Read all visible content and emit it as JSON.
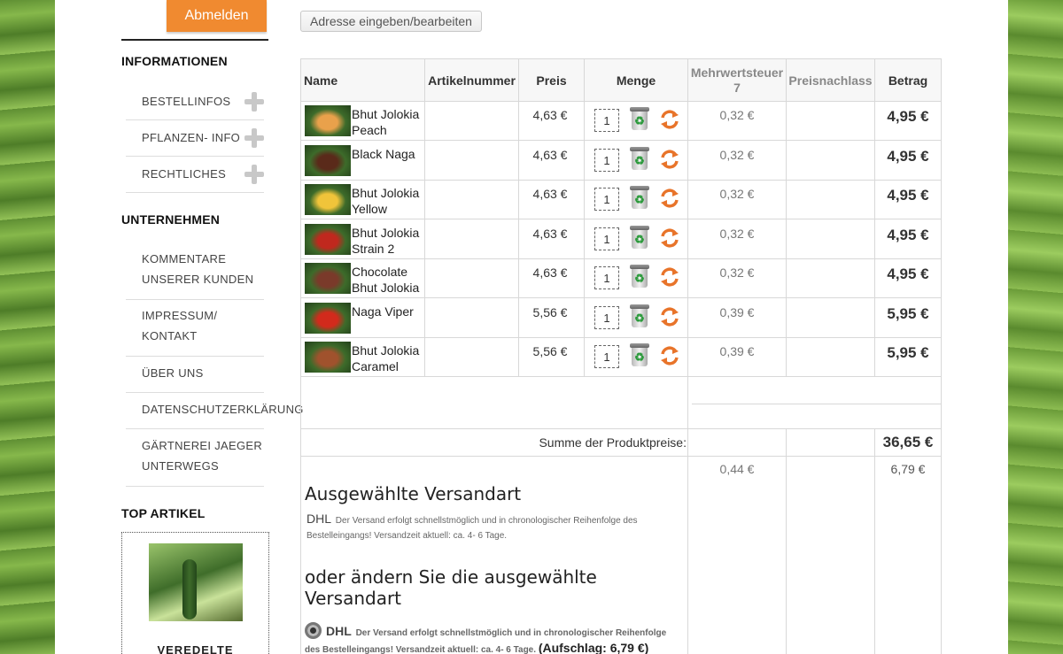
{
  "sidebar": {
    "logout_label": "Abmelden",
    "info_heading": "INFORMATIONEN",
    "info_items": [
      {
        "label": "BESTELLINFOS"
      },
      {
        "label": "PFLANZEN- INFO"
      },
      {
        "label": "RECHTLICHES"
      }
    ],
    "company_heading": "UNTERNEHMEN",
    "company_items": [
      {
        "line1": "KOMMENTARE",
        "line2": "UNSERER KUNDEN"
      },
      {
        "line1": "IMPRESSUM/",
        "line2": "KONTAKT"
      },
      {
        "line1": "ÜBER UNS",
        "line2": ""
      },
      {
        "line1": "DATENSCHUTZERKLÄRUNG",
        "line2": ""
      },
      {
        "line1": "GÄRTNEREI JAEGER",
        "line2": "UNTERWEGS"
      }
    ],
    "top_heading": "TOP ARTIKEL",
    "top_article_title": "VEREDELTE"
  },
  "address_button": "Adresse eingeben/bearbeiten",
  "table": {
    "headers": {
      "name": "Name",
      "article_number": "Artikelnummer",
      "price": "Preis",
      "quantity": "Menge",
      "vat_line1": "Mehrwertsteuer",
      "vat_line2": "7",
      "discount": "Preisnachlass",
      "amount": "Betrag"
    },
    "rows": [
      {
        "name1": "Bhut Jolokia",
        "name2": "Peach",
        "price": "4,63 €",
        "qty": "1",
        "vat": "0,32 €",
        "total": "4,95 €",
        "color": "#e9a14b"
      },
      {
        "name1": "Black Naga",
        "name2": "",
        "price": "4,63 €",
        "qty": "1",
        "vat": "0,32 €",
        "total": "4,95 €",
        "color": "#5a2a1a"
      },
      {
        "name1": "Bhut Jolokia",
        "name2": "Yellow",
        "price": "4,63 €",
        "qty": "1",
        "vat": "0,32 €",
        "total": "4,95 €",
        "color": "#f0c43a"
      },
      {
        "name1": "Bhut Jolokia",
        "name2": "Strain 2",
        "price": "4,63 €",
        "qty": "1",
        "vat": "0,32 €",
        "total": "4,95 €",
        "color": "#c0281e"
      },
      {
        "name1": "Chocolate",
        "name2": "Bhut Jolokia",
        "price": "4,63 €",
        "qty": "1",
        "vat": "0,32 €",
        "total": "4,95 €",
        "color": "#7a3a2a"
      },
      {
        "name1": "Naga Viper",
        "name2": "",
        "price": "5,56 €",
        "qty": "1",
        "vat": "0,39 €",
        "total": "5,95 €",
        "color": "#d22a1c"
      },
      {
        "name1": "Bhut Jolokia",
        "name2": "Caramel",
        "price": "5,56 €",
        "qty": "1",
        "vat": "0,39 €",
        "total": "5,95 €",
        "color": "#a0522d"
      }
    ],
    "sum_label": "Summe der Produktpreise:",
    "sum_value": "36,65 €"
  },
  "shipping": {
    "vat": "0,44 €",
    "cost": "6,79 €",
    "selected_title": "Ausgewählte Versandart",
    "carrier": "DHL",
    "description_line1": "Der Versand erfolgt schnellstmöglich und in chronologischer Reihenfolge des",
    "description_line2": "Bestelleingangs! Versandzeit aktuell: ca. 4- 6 Tage.",
    "change_title_line1": "oder ändern Sie die ausgewählte",
    "change_title_line2": "Versandart",
    "option_carrier": "DHL",
    "option_line1": "Der Versand erfolgt schnellstmöglich und in chronologischer Reihenfolge",
    "option_line2": "des Bestelleingangs! Versandzeit aktuell: ca. 4- 6 Tage.",
    "option_surcharge": "(Aufschlag: 6,79 €)"
  }
}
